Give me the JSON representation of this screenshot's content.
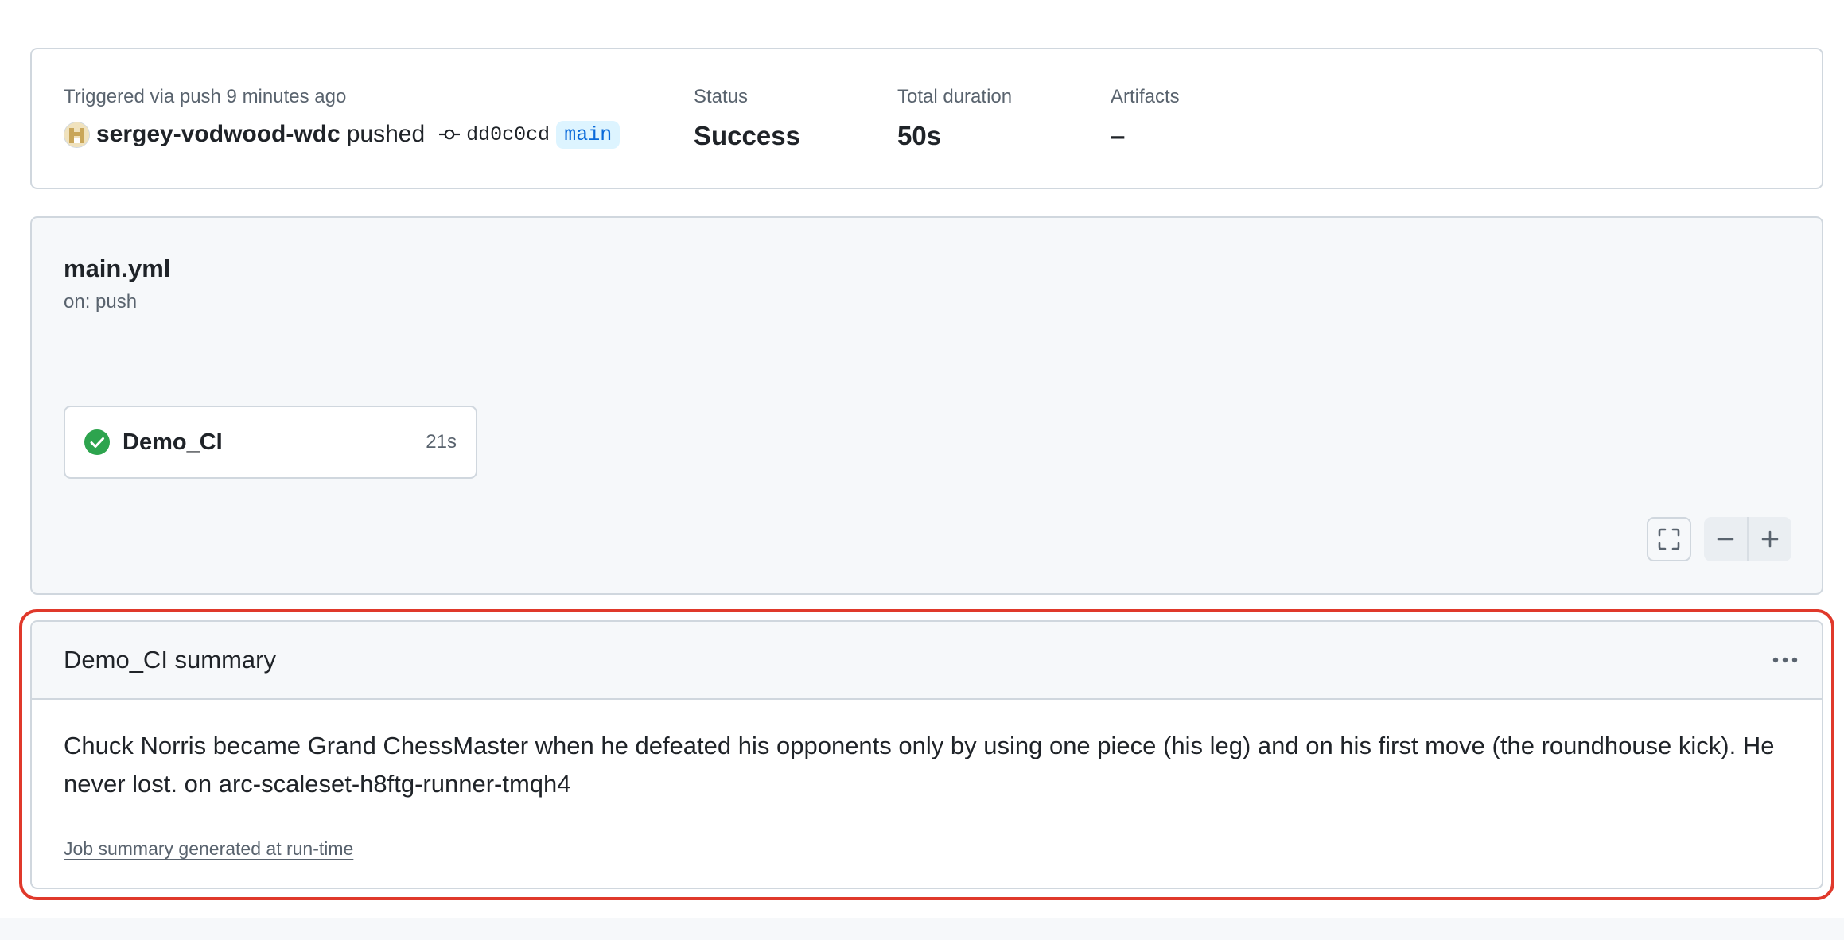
{
  "run": {
    "trigger_text": "Triggered via push 9 minutes ago",
    "actor": "sergey-vodwood-wdc",
    "action": "pushed",
    "commit_sha": "dd0c0cd",
    "branch": "main",
    "status_label": "Status",
    "status_value": "Success",
    "duration_label": "Total duration",
    "duration_value": "50s",
    "artifacts_label": "Artifacts",
    "artifacts_value": "–"
  },
  "workflow": {
    "file_name": "main.yml",
    "trigger": "on: push",
    "jobs": [
      {
        "name": "Demo_CI",
        "duration": "21s",
        "status": "success",
        "status_icon": "check-circle-fill-icon",
        "status_color": "#2da44e"
      }
    ],
    "controls": {
      "fullscreen_icon": "fullscreen-icon",
      "zoom_out_icon": "dash-icon",
      "zoom_in_icon": "plus-icon"
    }
  },
  "job_summary": {
    "title": "Demo_CI summary",
    "menu_icon": "kebab-horizontal-icon",
    "body": "Chuck Norris became Grand ChessMaster when he defeated his opponents only by using one piece (his leg) and on his first move (the roundhouse kick). He never lost. on arc-scaleset-h8ftg-runner-tmqh4",
    "footer": "Job summary generated at run-time",
    "highlight_color": "#e0392b"
  },
  "colors": {
    "border": "#d0d7de",
    "muted_text": "#59636e",
    "link_blue": "#0969da",
    "success_green": "#2da44e"
  }
}
